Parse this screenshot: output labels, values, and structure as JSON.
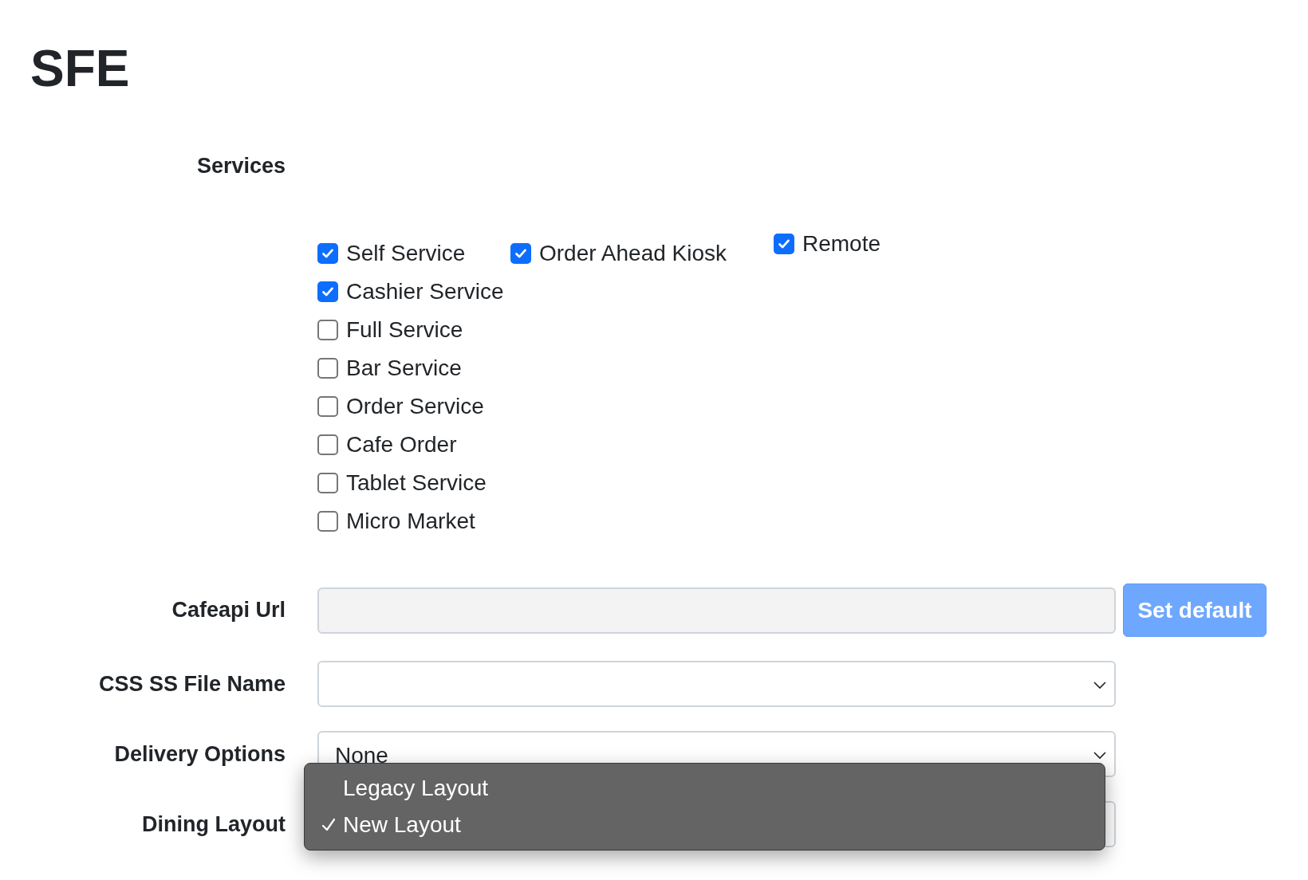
{
  "title": "SFE",
  "services": {
    "label": "Services",
    "rows": [
      [
        {
          "label": "Self Service",
          "checked": true
        },
        {
          "label": "Order Ahead Kiosk",
          "checked": true
        },
        {
          "label": "Remote",
          "checked": true
        }
      ],
      [
        {
          "label": "Cashier Service",
          "checked": true
        }
      ],
      [
        {
          "label": "Full Service",
          "checked": false
        }
      ],
      [
        {
          "label": "Bar Service",
          "checked": false
        }
      ],
      [
        {
          "label": "Order Service",
          "checked": false
        }
      ],
      [
        {
          "label": "Cafe Order",
          "checked": false
        }
      ],
      [
        {
          "label": "Tablet Service",
          "checked": false
        }
      ],
      [
        {
          "label": "Micro Market",
          "checked": false
        }
      ]
    ]
  },
  "cafeapi_url": {
    "label": "Cafeapi Url",
    "disabled": true,
    "button": "Set default"
  },
  "css_ss_file_name": {
    "label": "CSS SS File Name"
  },
  "delivery_options": {
    "label": "Delivery Options",
    "value": "None"
  },
  "dining_layout": {
    "label": "Dining Layout",
    "options": [
      {
        "label": "Legacy Layout",
        "selected": false
      },
      {
        "label": "New Layout",
        "selected": true
      }
    ]
  }
}
